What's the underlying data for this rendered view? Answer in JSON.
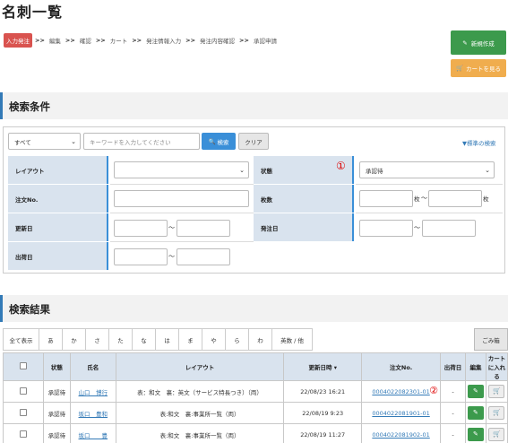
{
  "page_title": "名刺一覧",
  "breadcrumb": [
    {
      "label": "入力発注",
      "active": true
    },
    {
      "label": "編集"
    },
    {
      "label": "確認"
    },
    {
      "label": "カート"
    },
    {
      "label": "発注情報入力"
    },
    {
      "label": "発注内容確認"
    },
    {
      "label": "承認申請"
    }
  ],
  "breadcrumb_sep": ">>",
  "actions": {
    "new_label": "新規作成",
    "cart_label": "カートを見る"
  },
  "search": {
    "section_title": "検索条件",
    "scope_select": "すべて",
    "keyword_placeholder": "キーワードを入力してください",
    "search_button": "検索",
    "clear_button": "クリア",
    "advanced_link": "▼標準の検索",
    "labels": {
      "layout": "レイアウト",
      "status": "状態",
      "order_no": "注文No.",
      "count": "枚数",
      "updated": "更新日",
      "order_date": "発注日",
      "ship_date": "出荷日"
    },
    "status_value": "承認待",
    "tilde": "～",
    "count_unit_from": "枚",
    "count_unit_to": "枚",
    "annotation_1": "①"
  },
  "results": {
    "section_title": "検索結果",
    "kana_tabs": [
      "全て表示",
      "あ",
      "か",
      "さ",
      "た",
      "な",
      "は",
      "ま",
      "や",
      "ら",
      "わ",
      "英数 / 他"
    ],
    "trash_label": "ごみ箱",
    "columns": [
      "",
      "状態",
      "氏名",
      "レイアウト",
      "更新日時 ▾",
      "注文No.",
      "出荷日",
      "編集",
      "カートに入れる"
    ],
    "annotation_2": "②",
    "rows": [
      {
        "status": "承認待",
        "name": "山口　博行",
        "layout": "表：和文　裏：英文（サービス特長つき）（両）",
        "updated": "22/08/23 16:21",
        "order_no": "0004022082301-01",
        "ship": "-"
      },
      {
        "status": "承認待",
        "name": "坂口　豊和",
        "layout": "表:和文　裏:事業所一覧（両）",
        "updated": "22/08/19 9:23",
        "order_no": "0004022081901-01",
        "ship": "-"
      },
      {
        "status": "承認待",
        "name": "坂口　　豊",
        "layout": "表:和文　裏:事業所一覧（両）",
        "updated": "22/08/19 11:27",
        "order_no": "0004022081902-01",
        "ship": "-"
      }
    ]
  },
  "icons": {
    "edit": "edit-icon",
    "cart": "cart-icon",
    "search": "search-icon"
  }
}
